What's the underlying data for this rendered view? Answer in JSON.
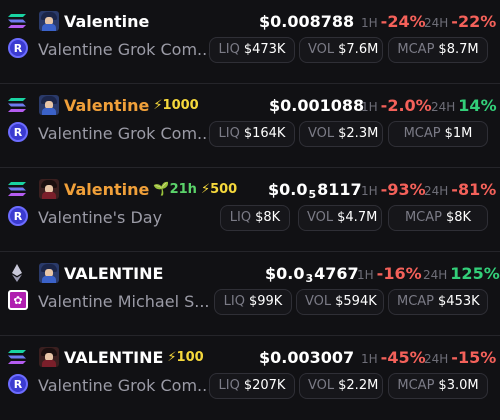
{
  "rows": [
    {
      "chain": "solana-icon",
      "dex": "raydium-icon",
      "name": "Valentine",
      "name_color": "#ffffff",
      "badges": [],
      "subname": "Valentine Grok Com...",
      "price": {
        "main": "$0.008788",
        "sub": "",
        "rest": ""
      },
      "h1": {
        "label": "1H",
        "value": "-24%",
        "sign": "neg"
      },
      "h24": {
        "label": "24H",
        "value": "-22%",
        "sign": "neg"
      },
      "liq": {
        "label": "LIQ",
        "value": "$473K"
      },
      "vol": {
        "label": "VOL",
        "value": "$7.6M"
      },
      "mcap": {
        "label": "MCAP",
        "value": "$8.7M"
      }
    },
    {
      "chain": "solana-icon",
      "dex": "raydium-icon",
      "name": "Valentine",
      "name_color": "#f0a03a",
      "badges": [
        {
          "icon": "bolt-icon",
          "text": "1000"
        }
      ],
      "subname": "Valentine Grok Com...",
      "price": {
        "main": "$0.001088",
        "sub": "",
        "rest": ""
      },
      "h1": {
        "label": "1H",
        "value": "-2.0%",
        "sign": "neg"
      },
      "h24": {
        "label": "24H",
        "value": "14%",
        "sign": "pos"
      },
      "liq": {
        "label": "LIQ",
        "value": "$164K"
      },
      "vol": {
        "label": "VOL",
        "value": "$2.3M"
      },
      "mcap": {
        "label": "MCAP",
        "value": "$1M"
      }
    },
    {
      "chain": "solana-icon",
      "dex": "raydium-icon",
      "name": "Valentine",
      "name_color": "#f0a03a",
      "badges": [
        {
          "icon": "sprout-icon",
          "text": "21h"
        },
        {
          "icon": "bolt-icon",
          "text": "500"
        }
      ],
      "subname": "Valentine's Day",
      "price": {
        "main": "$0.0",
        "sub": "5",
        "rest": "8117"
      },
      "h1": {
        "label": "1H",
        "value": "-93%",
        "sign": "neg"
      },
      "h24": {
        "label": "24H",
        "value": "-81%",
        "sign": "neg"
      },
      "liq": {
        "label": "LIQ",
        "value": "$8K"
      },
      "vol": {
        "label": "VOL",
        "value": "$4.7M"
      },
      "mcap": {
        "label": "MCAP",
        "value": "$8K"
      }
    },
    {
      "chain": "ethereum-icon",
      "dex": "uniswap-icon",
      "name": "VALENTINE",
      "name_color": "#ffffff",
      "badges": [],
      "subname": "Valentine Michael S...",
      "price": {
        "main": "$0.0",
        "sub": "3",
        "rest": "4767"
      },
      "h1": {
        "label": "1H",
        "value": "-16%",
        "sign": "neg"
      },
      "h24": {
        "label": "24H",
        "value": "125%",
        "sign": "pos"
      },
      "liq": {
        "label": "LIQ",
        "value": "$99K"
      },
      "vol": {
        "label": "VOL",
        "value": "$594K"
      },
      "mcap": {
        "label": "MCAP",
        "value": "$453K"
      }
    },
    {
      "chain": "solana-icon",
      "dex": "raydium-icon",
      "name": "VALENTINE",
      "name_color": "#ffffff",
      "badges": [
        {
          "icon": "bolt-icon",
          "text": "100"
        }
      ],
      "subname": "Valentine Grok Com...",
      "price": {
        "main": "$0.003007",
        "sub": "",
        "rest": ""
      },
      "h1": {
        "label": "1H",
        "value": "-45%",
        "sign": "neg"
      },
      "h24": {
        "label": "24H",
        "value": "-15%",
        "sign": "neg"
      },
      "liq": {
        "label": "LIQ",
        "value": "$207K"
      },
      "vol": {
        "label": "VOL",
        "value": "$2.2M"
      },
      "mcap": {
        "label": "MCAP",
        "value": "$3.0M"
      }
    }
  ]
}
